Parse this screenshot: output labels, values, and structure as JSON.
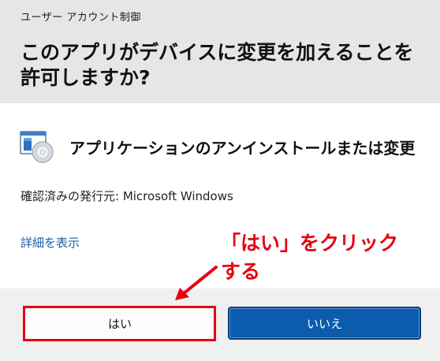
{
  "window": {
    "title": "ユーザー アカウント制御"
  },
  "prompt": {
    "heading": "このアプリがデバイスに変更を加えることを許可しますか?"
  },
  "app": {
    "icon": "programs-and-features-icon",
    "name": "アプリケーションのアンインストールまたは変更",
    "publisher": "確認済みの発行元: Microsoft Windows"
  },
  "details_link": "詳細を表示",
  "annotation": {
    "line1": "「はい」をクリック",
    "line2": "する",
    "color": "#e60012"
  },
  "buttons": {
    "yes_label": "はい",
    "no_label": "いいえ"
  },
  "colors": {
    "header_bg": "#e6e6e6",
    "footer_bg": "#f0f0f0",
    "primary_button": "#0b5cad",
    "link": "#1d5fa8",
    "highlight": "#e60012"
  }
}
